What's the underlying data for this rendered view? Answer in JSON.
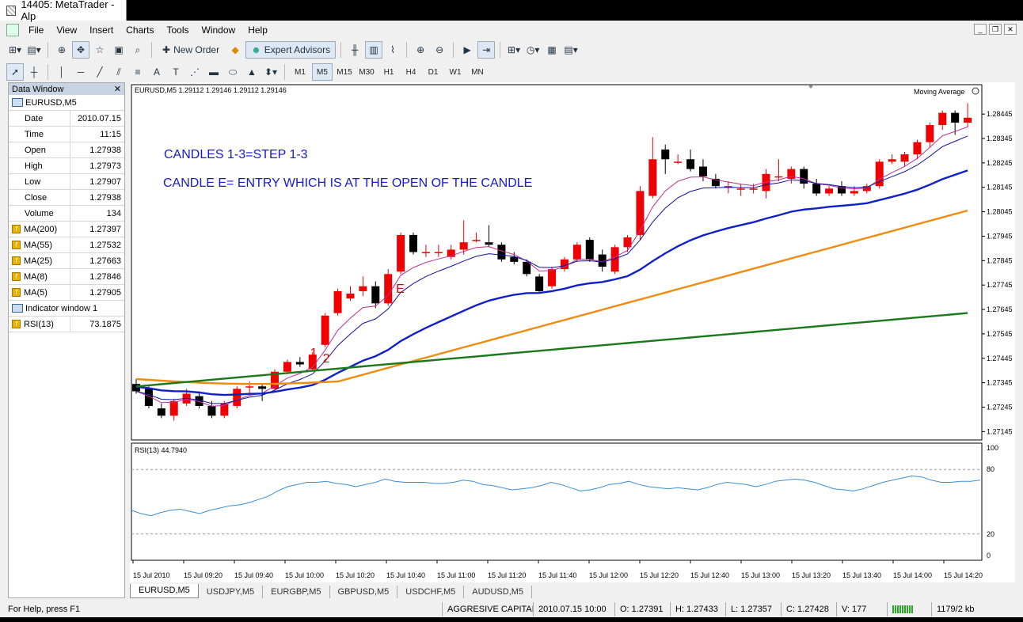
{
  "window": {
    "title": "14405: MetaTrader - Alp"
  },
  "menu": [
    "File",
    "View",
    "Insert",
    "Charts",
    "Tools",
    "Window",
    "Help"
  ],
  "toolbar": {
    "new_order": "New Order",
    "expert_advisors": "Expert Advisors"
  },
  "timeframes": [
    "M1",
    "M5",
    "M15",
    "M30",
    "H1",
    "H4",
    "D1",
    "W1",
    "MN"
  ],
  "active_timeframe": "M5",
  "data_window": {
    "title": "Data Window",
    "symbol": "EURUSD,M5",
    "rows": [
      {
        "k": "Date",
        "v": "2010.07.15"
      },
      {
        "k": "Time",
        "v": "11:15"
      },
      {
        "k": "Open",
        "v": "1.27938"
      },
      {
        "k": "High",
        "v": "1.27973"
      },
      {
        "k": "Low",
        "v": "1.27907"
      },
      {
        "k": "Close",
        "v": "1.27938"
      },
      {
        "k": "Volume",
        "v": "134"
      }
    ],
    "indicators": [
      {
        "k": "MA(200)",
        "v": "1.27397"
      },
      {
        "k": "MA(55)",
        "v": "1.27532"
      },
      {
        "k": "MA(25)",
        "v": "1.27663"
      },
      {
        "k": "MA(8)",
        "v": "1.27846"
      },
      {
        "k": "MA(5)",
        "v": "1.27905"
      }
    ],
    "indicator_window": "Indicator window 1",
    "rsi": {
      "k": "RSI(13)",
      "v": "73.1875"
    }
  },
  "chart_data": {
    "type": "candlestick",
    "title": "EURUSD,M5  1.29112 1.29146 1.29112 1.29146",
    "indicator_label": "Moving Average",
    "annotations": [
      "CANDLES 1-3=STEP 1-3",
      "CANDLE E= ENTRY WHICH IS AT THE OPEN OF THE CANDLE"
    ],
    "markers": [
      "1",
      "2",
      "3",
      "E"
    ],
    "price_ticks": [
      "1.28445",
      "1.28345",
      "1.28245",
      "1.28145",
      "1.28045",
      "1.27945",
      "1.27845",
      "1.27745",
      "1.27645",
      "1.27545",
      "1.27445",
      "1.27345",
      "1.27245",
      "1.27145"
    ],
    "ylim": [
      1.2713,
      1.2852
    ],
    "time_labels": [
      "15 Jul 2010",
      "15 Jul 09:20",
      "15 Jul 09:40",
      "15 Jul 10:00",
      "15 Jul 10:20",
      "15 Jul 10:40",
      "15 Jul 11:00",
      "15 Jul 11:20",
      "15 Jul 11:40",
      "15 Jul 12:00",
      "15 Jul 12:20",
      "15 Jul 12:40",
      "15 Jul 13:00",
      "15 Jul 13:20",
      "15 Jul 13:40",
      "15 Jul 14:00",
      "15 Jul 14:20"
    ],
    "candles": [
      [
        1.2734,
        1.2736,
        1.273,
        1.2731
      ],
      [
        1.2732,
        1.2733,
        1.2724,
        1.2725
      ],
      [
        1.2724,
        1.2726,
        1.272,
        1.2721
      ],
      [
        1.2721,
        1.2728,
        1.2719,
        1.2727
      ],
      [
        1.2726,
        1.2732,
        1.2725,
        1.273
      ],
      [
        1.2729,
        1.2731,
        1.2724,
        1.2725
      ],
      [
        1.2725,
        1.2727,
        1.272,
        1.2721
      ],
      [
        1.2721,
        1.2727,
        1.272,
        1.2726
      ],
      [
        1.2725,
        1.2733,
        1.2724,
        1.2732
      ],
      [
        1.2733,
        1.2735,
        1.273,
        1.2733
      ],
      [
        1.2733,
        1.2734,
        1.2727,
        1.2732
      ],
      [
        1.2732,
        1.274,
        1.2731,
        1.2739
      ],
      [
        1.2739,
        1.2744,
        1.2738,
        1.2743
      ],
      [
        1.2743,
        1.2745,
        1.2741,
        1.2742
      ],
      [
        1.274,
        1.2747,
        1.2739,
        1.2746
      ],
      [
        1.275,
        1.2763,
        1.2749,
        1.2762
      ],
      [
        1.2763,
        1.2773,
        1.2762,
        1.2772
      ],
      [
        1.2769,
        1.2774,
        1.2768,
        1.2771
      ],
      [
        1.2772,
        1.2778,
        1.277,
        1.2774
      ],
      [
        1.2774,
        1.2776,
        1.2765,
        1.2767
      ],
      [
        1.2767,
        1.2781,
        1.2766,
        1.2779
      ],
      [
        1.278,
        1.2796,
        1.2779,
        1.2795
      ],
      [
        1.2795,
        1.2796,
        1.2787,
        1.2788
      ],
      [
        1.2788,
        1.2791,
        1.2786,
        1.2788
      ],
      [
        1.2788,
        1.2791,
        1.2786,
        1.2788
      ],
      [
        1.2786,
        1.2791,
        1.2785,
        1.2789
      ],
      [
        1.2789,
        1.2801,
        1.2787,
        1.2792
      ],
      [
        1.2793,
        1.2796,
        1.2792,
        1.2793
      ],
      [
        1.2792,
        1.2799,
        1.279,
        1.2791
      ],
      [
        1.2791,
        1.2792,
        1.2784,
        1.2785
      ],
      [
        1.2786,
        1.2788,
        1.2783,
        1.2784
      ],
      [
        1.2784,
        1.2785,
        1.2778,
        1.2779
      ],
      [
        1.2778,
        1.2779,
        1.2771,
        1.2772
      ],
      [
        1.2774,
        1.2782,
        1.2773,
        1.2781
      ],
      [
        1.2781,
        1.2786,
        1.278,
        1.2785
      ],
      [
        1.2785,
        1.2792,
        1.2784,
        1.2791
      ],
      [
        1.2793,
        1.2794,
        1.2784,
        1.2785
      ],
      [
        1.2787,
        1.2789,
        1.278,
        1.2782
      ],
      [
        1.278,
        1.2791,
        1.2779,
        1.279
      ],
      [
        1.279,
        1.2795,
        1.2788,
        1.2794
      ],
      [
        1.2795,
        1.2815,
        1.2793,
        1.2813
      ],
      [
        1.2811,
        1.2835,
        1.281,
        1.2826
      ],
      [
        1.283,
        1.2832,
        1.282,
        1.2826
      ],
      [
        1.2825,
        1.2828,
        1.2824,
        1.2825
      ],
      [
        1.2826,
        1.283,
        1.2821,
        1.2822
      ],
      [
        1.2823,
        1.2826,
        1.2817,
        1.2819
      ],
      [
        1.2818,
        1.282,
        1.2814,
        1.2815
      ],
      [
        1.2815,
        1.2817,
        1.2812,
        1.2815
      ],
      [
        1.2814,
        1.2816,
        1.2811,
        1.2814
      ],
      [
        1.2814,
        1.2816,
        1.2812,
        1.2814
      ],
      [
        1.2813,
        1.2822,
        1.281,
        1.282
      ],
      [
        1.2819,
        1.2826,
        1.2817,
        1.2819
      ],
      [
        1.2818,
        1.2823,
        1.2816,
        1.2822
      ],
      [
        1.2822,
        1.2823,
        1.2814,
        1.2816
      ],
      [
        1.2816,
        1.2818,
        1.2811,
        1.2812
      ],
      [
        1.2812,
        1.2815,
        1.2811,
        1.2814
      ],
      [
        1.2815,
        1.2817,
        1.2811,
        1.2812
      ],
      [
        1.2812,
        1.2815,
        1.2811,
        1.2813
      ],
      [
        1.2813,
        1.2816,
        1.2812,
        1.2815
      ],
      [
        1.2815,
        1.2826,
        1.2814,
        1.2825
      ],
      [
        1.2825,
        1.2828,
        1.2824,
        1.2826
      ],
      [
        1.2825,
        1.2829,
        1.2823,
        1.2828
      ],
      [
        1.2828,
        1.2834,
        1.2826,
        1.2833
      ],
      [
        1.2833,
        1.2841,
        1.2831,
        1.284
      ],
      [
        1.284,
        1.2846,
        1.2838,
        1.2845
      ],
      [
        1.2845,
        1.2846,
        1.2836,
        1.2841
      ],
      [
        1.2841,
        1.2849,
        1.2839,
        1.2843
      ]
    ],
    "series": [
      {
        "name": "MA(5)",
        "color": "#c03090"
      },
      {
        "name": "MA(8)",
        "color": "#1010a0"
      },
      {
        "name": "MA(25)",
        "color": "#1020c8"
      },
      {
        "name": "MA(55)",
        "color": "#f08a10"
      },
      {
        "name": "MA(200)",
        "color": "#1a7a1a"
      }
    ],
    "rsi": {
      "label": "RSI(13) 44.7940",
      "ticks": [
        "100",
        "80",
        "20",
        "0"
      ],
      "levels": [
        80,
        20
      ],
      "color": "#3a8ed8",
      "values": [
        42,
        39,
        37,
        40,
        42,
        43,
        41,
        39,
        42,
        44,
        46,
        47,
        49,
        52,
        55,
        60,
        64,
        66,
        68,
        68,
        69,
        67,
        66,
        64,
        66,
        68,
        71,
        69,
        68,
        68,
        68,
        67,
        67,
        68,
        70,
        69,
        66,
        65,
        63,
        61,
        62,
        63,
        65,
        68,
        66,
        63,
        60,
        61,
        63,
        66,
        67,
        69,
        66,
        64,
        63,
        62,
        63,
        62,
        61,
        63,
        66,
        68,
        67,
        66,
        64,
        66,
        69,
        70,
        71,
        70,
        68,
        65,
        62,
        61,
        60,
        62,
        65,
        68,
        70,
        72,
        74,
        73,
        70,
        68,
        68,
        69,
        69,
        70
      ]
    }
  },
  "tabs": [
    "EURUSD,M5",
    "USDJPY,M5",
    "EURGBP,M5",
    "GBPUSD,M5",
    "USDCHF,M5",
    "AUDUSD,M5"
  ],
  "status": {
    "help": "For Help, press F1",
    "profile": "AGGRESIVE CAPITAL T",
    "datetime": "2010.07.15 10:00",
    "open": "O: 1.27391",
    "high": "H: 1.27433",
    "low": "L: 1.27357",
    "close": "C: 1.27428",
    "volume": "V: 177",
    "traffic": "1179/2 kb"
  }
}
